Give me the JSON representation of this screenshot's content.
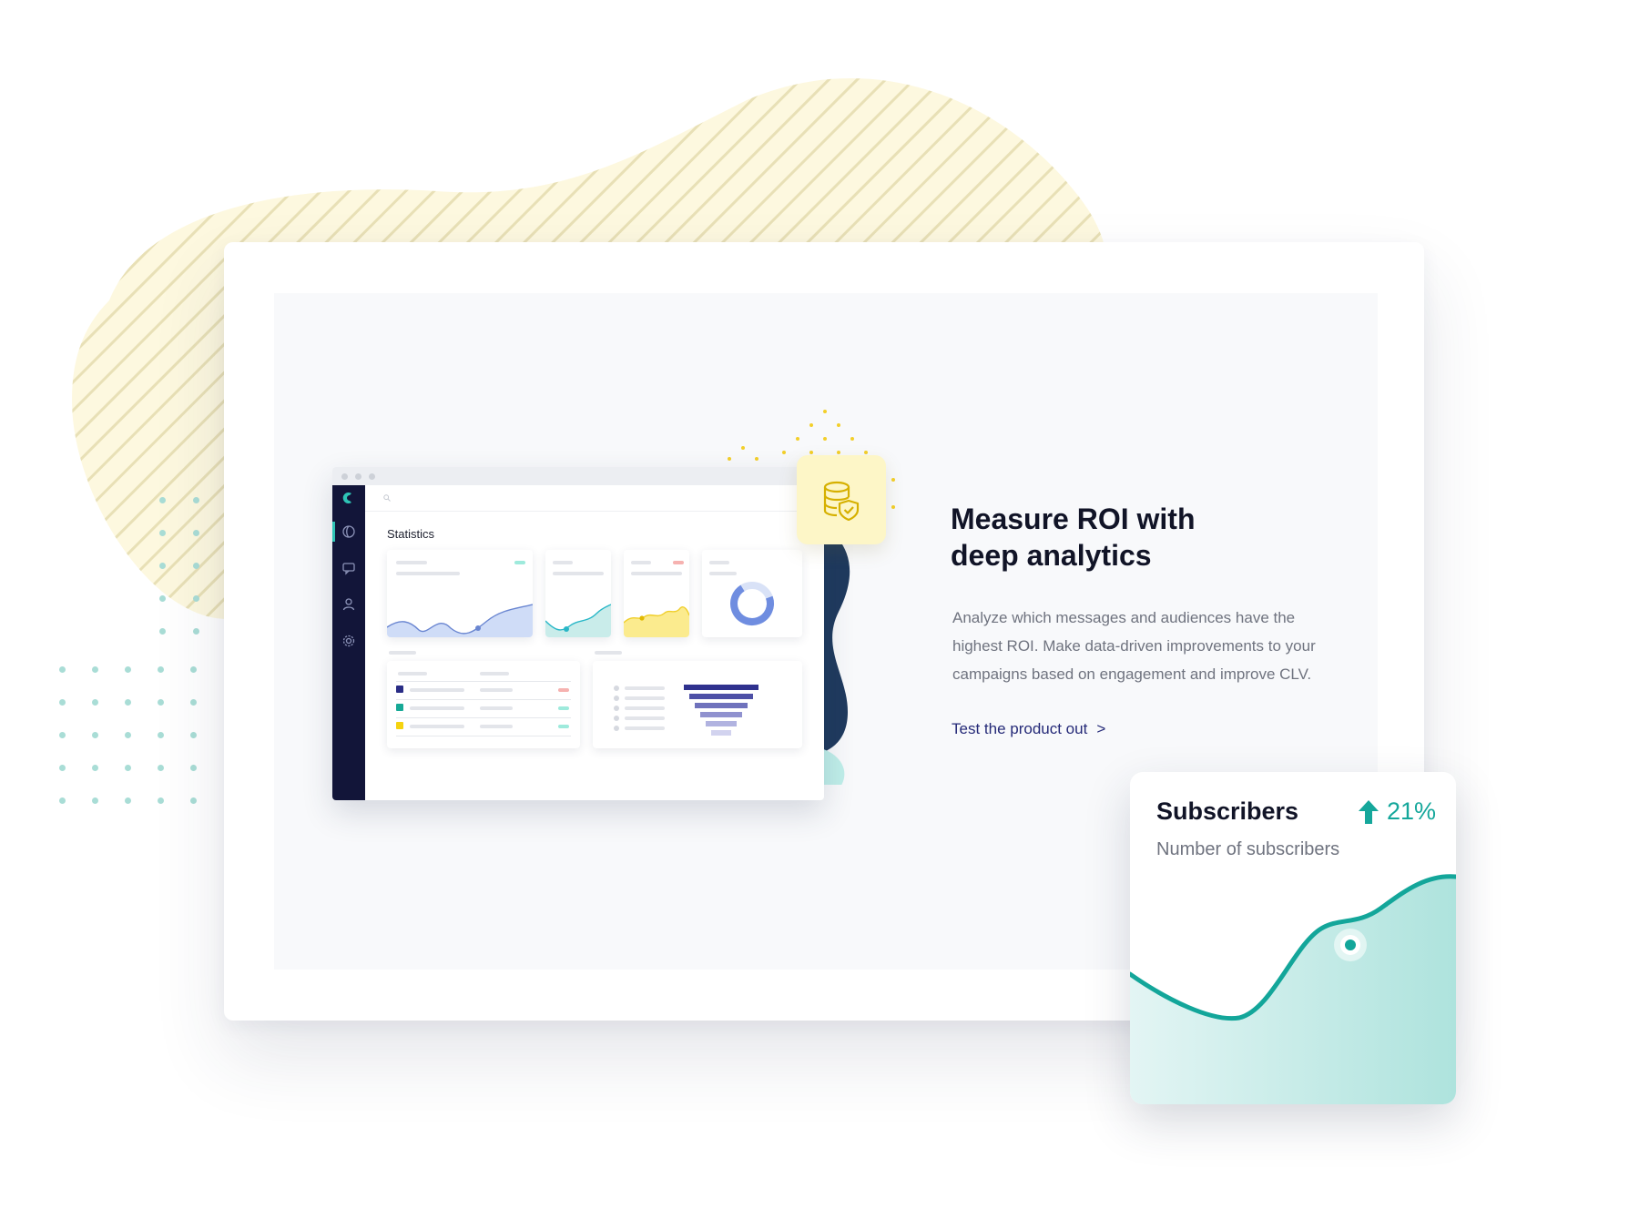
{
  "colors": {
    "accent_teal": "#15a79b",
    "navy_sidebar": "#121539",
    "link": "#252a78",
    "stripe_yellow": "#fbf5d2"
  },
  "app": {
    "title": "Statistics",
    "sidebar_icons": [
      "logo-icon",
      "globe-icon",
      "chat-icon",
      "user-icon",
      "gear-icon"
    ]
  },
  "feature": {
    "headline": "Measure ROI with deep analytics",
    "description": "Analyze which messages and audiences have the highest ROI. Make data-driven improvements to your campaigns based on engagement and improve CLV.",
    "cta_label": "Test the product out",
    "cta_arrow": ">"
  },
  "subscribers": {
    "title": "Subscribers",
    "subtitle": "Number of subscribers",
    "trend_value": "21%",
    "trend_icon": "arrow-up-icon"
  }
}
